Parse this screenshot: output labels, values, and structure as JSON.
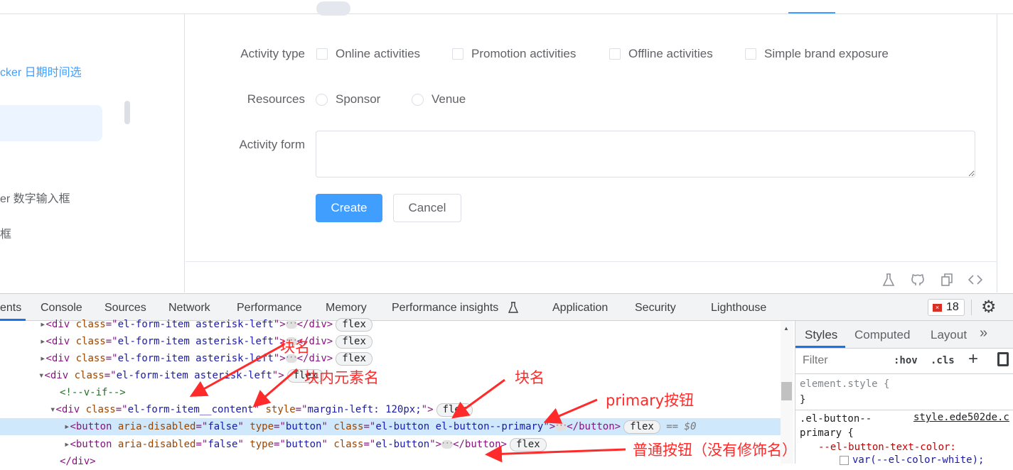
{
  "sidebar": {
    "items": [
      {
        "label": "cker 日期时间选",
        "active": true
      },
      {
        "label": "er 数字输入框"
      },
      {
        "label": "框"
      }
    ]
  },
  "form": {
    "activity_type": {
      "label": "Activity type",
      "options": [
        "Online activities",
        "Promotion activities",
        "Offline activities",
        "Simple brand exposure"
      ]
    },
    "resources": {
      "label": "Resources",
      "options": [
        "Sponsor",
        "Venue"
      ]
    },
    "activity_form": {
      "label": "Activity form",
      "value": ""
    },
    "create_label": "Create",
    "cancel_label": "Cancel"
  },
  "footer_icons": [
    "flask-icon",
    "github-icon",
    "copy-icon",
    "code-icon"
  ],
  "devtools": {
    "tabs": [
      "ents",
      "Console",
      "Sources",
      "Network",
      "Performance",
      "Memory",
      "Performance insights",
      "Application",
      "Security",
      "Lighthouse"
    ],
    "active_tab": "ents",
    "error_count": "18",
    "elements": {
      "lines": [
        {
          "tag": "div",
          "class": "el-form-item asterisk-left",
          "badge": "flex"
        },
        {
          "tag": "div",
          "class": "el-form-item asterisk-left",
          "badge": "flex"
        },
        {
          "tag": "div",
          "class": "el-form-item asterisk-left",
          "badge": "flex"
        },
        {
          "tag": "div",
          "class": "el-form-item asterisk-left",
          "badge": "flex"
        },
        {
          "comment": "<!--v-if-->"
        },
        {
          "tag": "div",
          "class": "el-form-item__content",
          "style": "margin-left: 120px;",
          "badge": "flex"
        },
        {
          "tag": "button",
          "aria_disabled": "false",
          "type": "button",
          "class": "el-button el-button--primary",
          "badge": "flex",
          "selected": "== $0"
        },
        {
          "tag": "button",
          "aria_disabled": "false",
          "type": "button",
          "class": "el-button",
          "badge": "flex"
        },
        {
          "close": "</div>"
        }
      ]
    },
    "styles": {
      "tabs": [
        "Styles",
        "Computed",
        "Layout"
      ],
      "filter_placeholder": "Filter",
      "hov": ":hov",
      "cls": ".cls",
      "element_style": "element.style {",
      "close_brace": "}",
      "rule_selector_1": ".el-button--",
      "rule_selector_2": "primary {",
      "rule_source": "style.ede502de.c",
      "rule_prop": "--el-button-text-color:",
      "rule_value": "var(--el-color-white);"
    }
  },
  "annotations": [
    "块名",
    "块内元素名",
    "块名",
    "primary按钮",
    "普通按钮（没有修饰名）"
  ],
  "colors": {
    "primary": "#409eff",
    "annotation": "#ff2a2a",
    "selected_row": "#cfe8fc"
  }
}
